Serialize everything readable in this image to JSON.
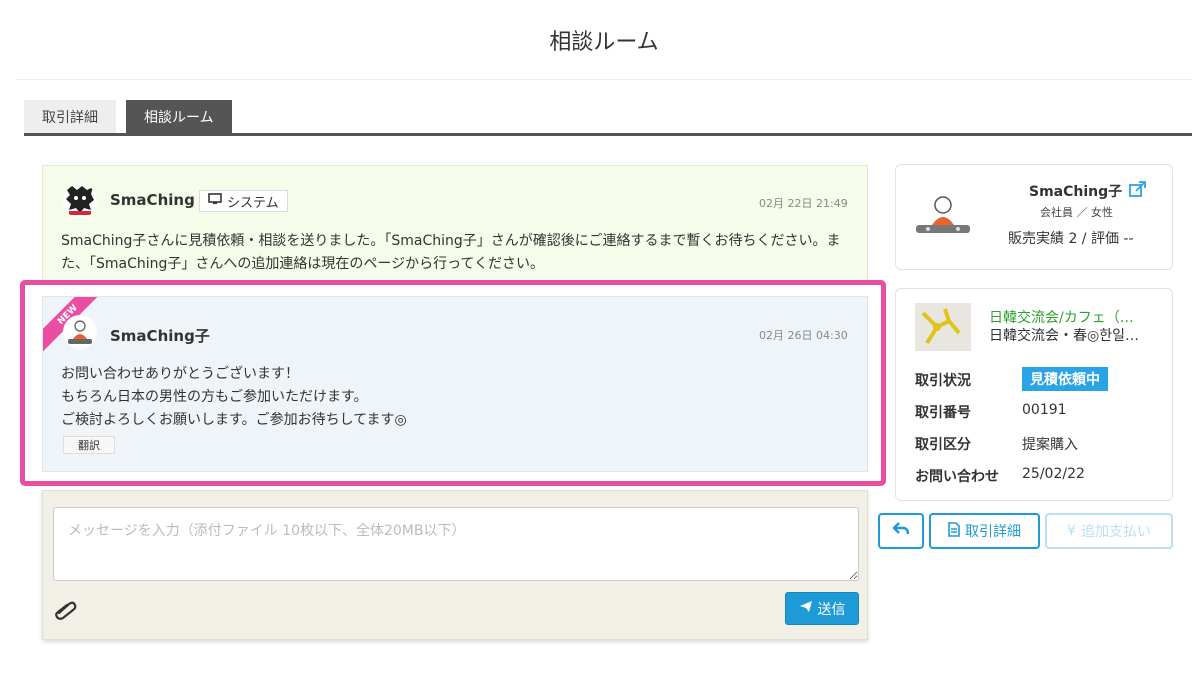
{
  "page": {
    "title": "相談ルーム"
  },
  "tabs": [
    {
      "label": "取引詳細",
      "active": false
    },
    {
      "label": "相談ルーム",
      "active": true
    }
  ],
  "messages": [
    {
      "sender": "SmaChing",
      "badge": "システム",
      "time": "02月 22日 21:49",
      "body": "SmaChing子さんに見積依頼・相談を送りました。「SmaChing子」さんが確認後にご連絡するまで暫くお待ちください。また、「SmaChing子」さんへの追加連絡は現在のページから行ってください。"
    },
    {
      "sender": "SmaChing子",
      "ribbon": "NEW",
      "time": "02月 26日 04:30",
      "lines": [
        "お問い合わせありがとうございます！",
        "もちろん日本の男性の方もご参加いただけます。",
        "ご検討よろしくお願いします。ご参加お待ちしてます◎"
      ],
      "translate_label": "翻訳"
    }
  ],
  "composer": {
    "placeholder": "メッセージを入力（添付ファイル 10枚以下、全体20MB以下）",
    "send_label": "送信"
  },
  "profile": {
    "name": "SmaChing子",
    "sub": "会社員 ／ 女性",
    "sales": "販売実績 2 / 評価 --"
  },
  "deal": {
    "event_title": "日韓交流会/カフェ（…",
    "event_sub": "日韓交流会・春◎한일…",
    "status_label": "取引状況",
    "status_value": "見積依頼中",
    "number_label": "取引番号",
    "number_value": "00191",
    "type_label": "取引区分",
    "type_value": "提案購入",
    "inquiry_label": "お問い合わせ",
    "inquiry_value": "25/02/22"
  },
  "actions": {
    "detail_label": "取引詳細",
    "extra_pay_label": "追加支払い"
  },
  "colors": {
    "accent": "#1e9bd6",
    "highlight": "#ea4ea3",
    "status": "#2aa4e6",
    "event_link": "#2fa12f"
  }
}
